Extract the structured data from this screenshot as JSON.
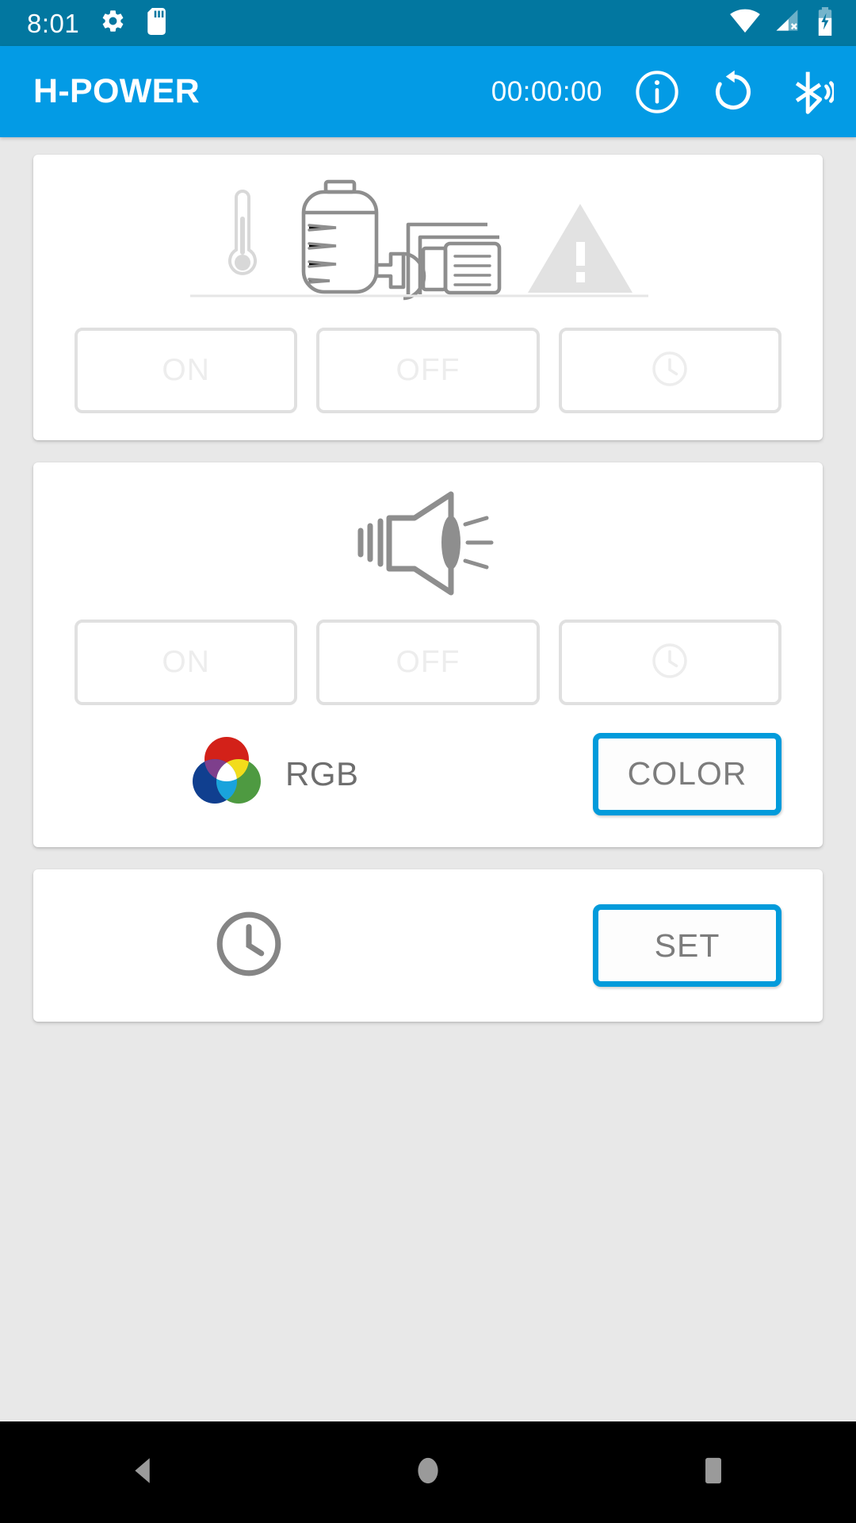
{
  "status_bar": {
    "time": "8:01",
    "background": "#0277A0",
    "icons": [
      {
        "name": "gear-icon",
        "label": "settings"
      },
      {
        "name": "sd-card-icon",
        "label": "sd card"
      },
      {
        "name": "wifi-icon",
        "label": "wifi full"
      },
      {
        "name": "cellular-no-sim-icon",
        "label": "no sim"
      },
      {
        "name": "battery-charging-icon",
        "label": "charging"
      }
    ]
  },
  "app_bar": {
    "title": "H-POWER",
    "timer": "00:00:00",
    "background": "#039BE5",
    "actions": [
      {
        "name": "info-icon",
        "label": "Info"
      },
      {
        "name": "refresh-icon",
        "label": "Reset"
      },
      {
        "name": "bluetooth-icon",
        "label": "Bluetooth"
      }
    ]
  },
  "cards": {
    "pump": {
      "illustration": "water-pump-illustration",
      "indicators": [
        "thermometer-icon",
        "warning-triangle-icon"
      ],
      "buttons": [
        {
          "name": "pump-on-button",
          "label": "ON",
          "enabled": false
        },
        {
          "name": "pump-off-button",
          "label": "OFF",
          "enabled": false
        },
        {
          "name": "pump-timer-button",
          "label": "",
          "icon": "clock-icon",
          "enabled": false
        }
      ]
    },
    "siren": {
      "illustration": "siren-horn-icon",
      "buttons": [
        {
          "name": "siren-on-button",
          "label": "ON",
          "enabled": false
        },
        {
          "name": "siren-off-button",
          "label": "OFF",
          "enabled": false
        },
        {
          "name": "siren-timer-button",
          "label": "",
          "icon": "clock-icon",
          "enabled": false
        }
      ],
      "rgb": {
        "swatch": "rgb-venn-icon",
        "label": "RGB",
        "button_label": "COLOR"
      }
    },
    "timer": {
      "icon": "clock-icon",
      "button_label": "SET"
    }
  },
  "nav_bar": {
    "background": "#000000",
    "buttons": [
      {
        "name": "nav-back-button",
        "label": "Back"
      },
      {
        "name": "nav-home-button",
        "label": "Home"
      },
      {
        "name": "nav-recents-button",
        "label": "Recents"
      }
    ]
  },
  "colors": {
    "accent": "#039BE5",
    "accent_border": "#029BDB",
    "status_bar": "#0277A0",
    "page_bg": "#E8E8E8",
    "card_bg": "#FFFFFF",
    "disabled_border": "#E0E0E0",
    "disabled_text": "#EDEDED",
    "icon_gray": "#878787",
    "label_gray": "#7C7C7C",
    "rgb_red": "#D32119",
    "rgb_green": "#4E9A41",
    "rgb_blue": "#103F8F"
  }
}
